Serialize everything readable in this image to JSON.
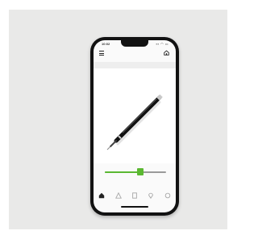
{
  "status_bar": {
    "time": "10:02",
    "indicators": "▪▪ ◠ ▭"
  },
  "header": {
    "menu_icon": "hamburger-menu",
    "right_icon": "home-outline"
  },
  "viewer": {
    "content": "stylus-pen-3d-render"
  },
  "slider": {
    "value": 0.58,
    "accent_color": "#5bb832"
  },
  "tab_bar": {
    "tabs": [
      {
        "icon": "home-icon",
        "active": true
      },
      {
        "icon": "triangle-icon",
        "active": false
      },
      {
        "icon": "document-icon",
        "active": false
      },
      {
        "icon": "location-pin-icon",
        "active": false
      },
      {
        "icon": "circle-icon",
        "active": false
      }
    ]
  }
}
